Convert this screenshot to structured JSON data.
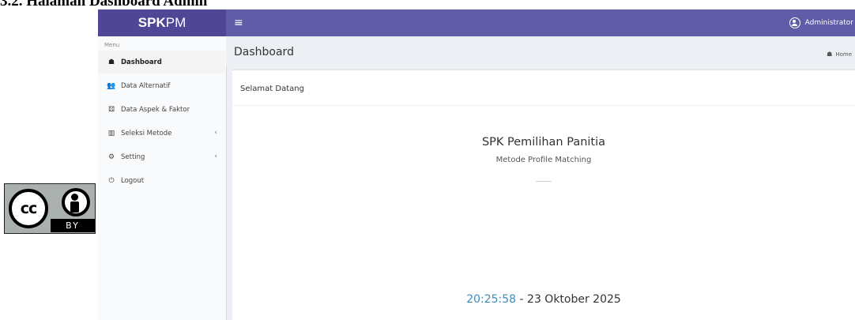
{
  "document": {
    "heading": "3.2. Halaman Dashboard Admin",
    "license_badge": {
      "cc_text": "cc",
      "by_text": "BY"
    }
  },
  "app": {
    "logo_bold": "SPK",
    "logo_rest": "PM",
    "navbar": {
      "menu_toggle_icon": "≡",
      "user_name": "Administrator"
    },
    "sidebar": {
      "header": "Menu",
      "items": [
        {
          "label": "Dashboard",
          "icon": "dashboard-icon",
          "glyph": "☗",
          "active": true
        },
        {
          "label": "Data Alternatif",
          "icon": "users-icon",
          "glyph": "👥",
          "active": false
        },
        {
          "label": "Data Aspek & Faktor",
          "icon": "cubes-icon",
          "glyph": "⚄",
          "active": false
        },
        {
          "label": "Seleksi Metode",
          "icon": "bar-chart-icon",
          "glyph": "▥",
          "active": false,
          "chevron": "‹"
        },
        {
          "label": "Setting",
          "icon": "cog-icon",
          "glyph": "⚙",
          "active": false,
          "chevron": "‹"
        },
        {
          "label": "Logout",
          "icon": "power-icon",
          "glyph": "⏻",
          "active": false
        }
      ]
    },
    "content": {
      "page_title": "Dashboard",
      "breadcrumb_home": "Home",
      "breadcrumb_icon_glyph": "☗",
      "box_title": "Selamat Datang",
      "main_title": "SPK Pemilihan Panitia",
      "subtitle": "Metode Profile Matching",
      "clock_time": "20:25:58",
      "clock_separator": " - ",
      "clock_date": "23 Oktober 2025"
    },
    "colors": {
      "navbar": "#605ca8",
      "logo_bar": "#4f4796",
      "accent_time": "#3c8dbc"
    }
  }
}
